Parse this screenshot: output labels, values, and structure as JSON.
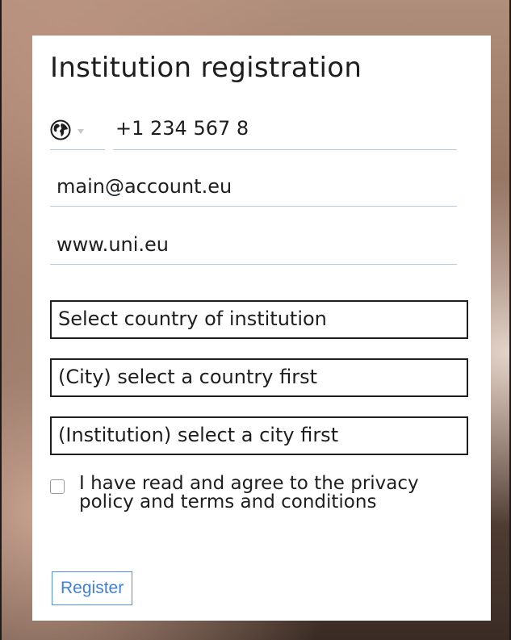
{
  "form": {
    "title": "Institution registration",
    "phone": {
      "country_icon": "globe-icon",
      "value": "+1 234 567 8"
    },
    "email": {
      "value": "main@account.eu"
    },
    "website": {
      "value": "www.uni.eu"
    },
    "country_select": {
      "selected": "Select country of institution"
    },
    "city_select": {
      "selected": "(City) select a country first"
    },
    "institution_select": {
      "selected": "(Institution) select a city first"
    },
    "agree": {
      "checked": false,
      "label": "I have read and agree to the privacy policy and terms and conditions"
    },
    "register_label": "Register"
  },
  "colors": {
    "accent": "#3f7fe0",
    "field_underline": "#b7c9dc",
    "text": "#1e1e1e"
  }
}
